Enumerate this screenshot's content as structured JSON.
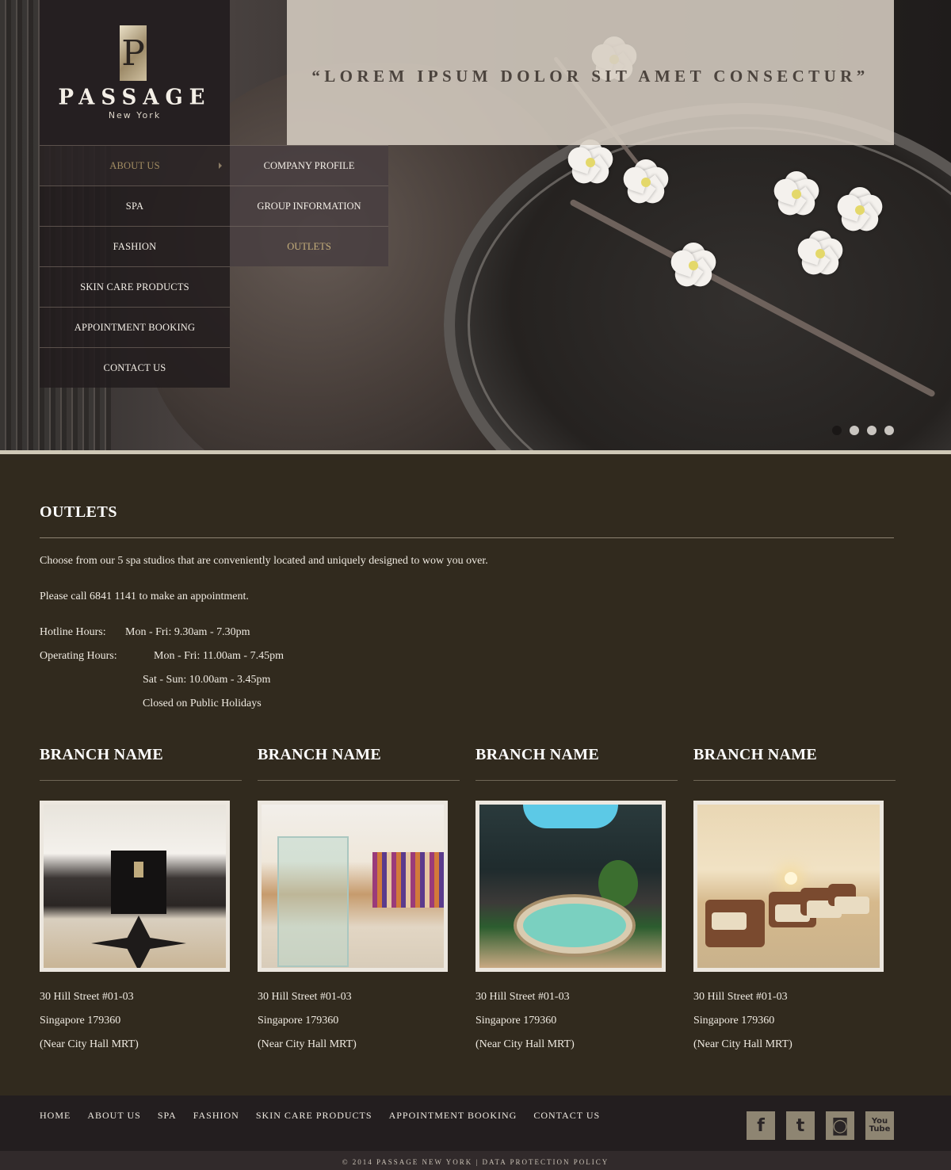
{
  "hero": {
    "quote": "“LOREM IPSUM DOLOR SIT AMET CONSECTUR”",
    "slides": [
      true,
      false,
      false,
      false
    ]
  },
  "logo": {
    "mark": "P",
    "word": "PASSAGE",
    "sub": "New York"
  },
  "nav": {
    "items": [
      {
        "label": "ABOUT US"
      },
      {
        "label": "SPA"
      },
      {
        "label": "FASHION"
      },
      {
        "label": "SKIN CARE PRODUCTS"
      },
      {
        "label": "APPOINTMENT BOOKING"
      },
      {
        "label": "CONTACT US"
      }
    ],
    "submenu": [
      {
        "label": "COMPANY PROFILE"
      },
      {
        "label": "GROUP INFORMATION"
      },
      {
        "label": "OUTLETS"
      }
    ]
  },
  "page": {
    "title": "OUTLETS",
    "intro": "Choose from our 5 spa studios that are conveniently located and uniquely designed to wow you over.",
    "call": "Please call 6841 1141 to make an appointment.",
    "hotline_label": "Hotline Hours:",
    "hotline_value": "Mon - Fri: 9.30am - 7.30pm",
    "operating_label": "Operating Hours:",
    "operating_1": "Mon - Fri: 11.00am - 7.45pm",
    "operating_2": "Sat - Sun: 10.00am - 3.45pm",
    "operating_3": "Closed on Public Holidays"
  },
  "branches": [
    {
      "name": "BRANCH NAME",
      "line1": "30 Hill Street #01-03",
      "line2": "Singapore 179360",
      "line3": "(Near City Hall MRT)"
    },
    {
      "name": "BRANCH NAME",
      "line1": "30 Hill Street #01-03",
      "line2": "Singapore 179360",
      "line3": "(Near City Hall MRT)"
    },
    {
      "name": "BRANCH NAME",
      "line1": "30 Hill Street #01-03",
      "line2": "Singapore 179360",
      "line3": "(Near City Hall MRT)"
    },
    {
      "name": "BRANCH NAME",
      "line1": "30 Hill Street #01-03",
      "line2": "Singapore 179360",
      "line3": "(Near City Hall MRT)"
    }
  ],
  "footer": {
    "links": [
      "HOME",
      "ABOUT US",
      "SPA",
      "FASHION",
      "SKIN CARE PRODUCTS",
      "APPOINTMENT BOOKING",
      "CONTACT US"
    ],
    "social": [
      {
        "icon": "facebook-icon",
        "glyph": "f"
      },
      {
        "icon": "twitter-icon",
        "glyph": "t"
      },
      {
        "icon": "instagram-icon",
        "glyph": "◙"
      },
      {
        "icon": "youtube-icon",
        "glyph": "You Tube"
      }
    ],
    "copyright": "© 2014 PASSAGE NEW YORK | DATA PROTECTION POLICY"
  },
  "colors": {
    "background": "#312a1e",
    "nav_active": "#a48e63",
    "submenu_active": "#c7b07c",
    "social_tile": "#8e8572"
  }
}
